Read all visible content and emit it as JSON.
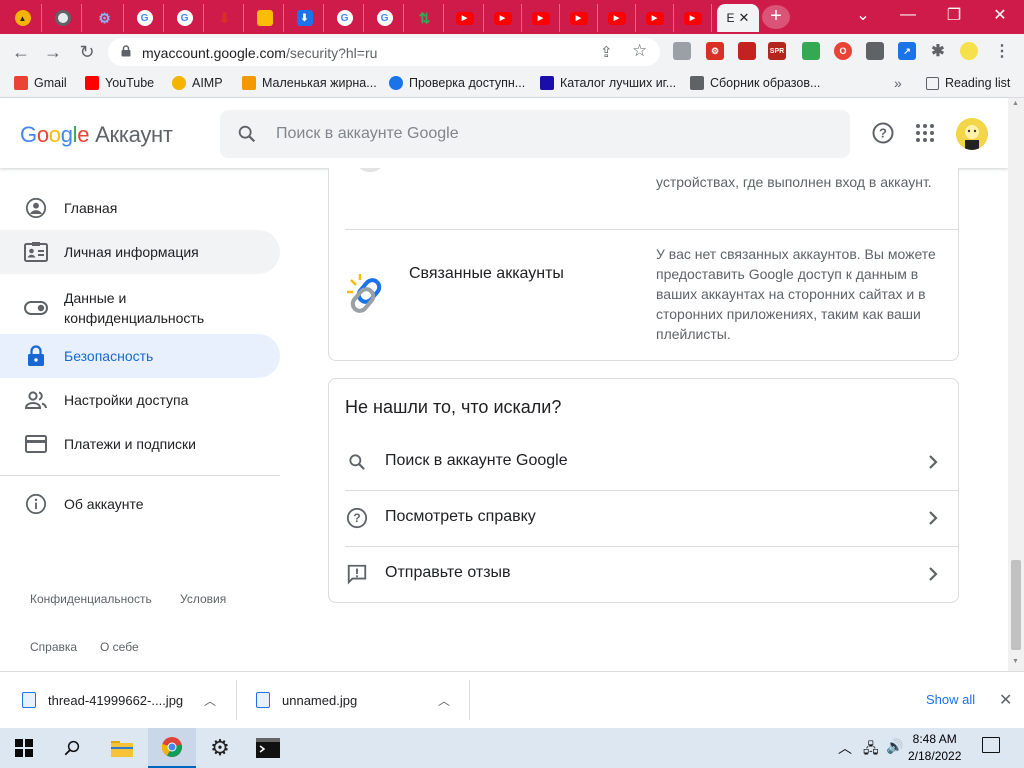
{
  "browser": {
    "tabs": [
      {
        "icon": "aimp-icon",
        "color": "#f5b400"
      },
      {
        "icon": "chrome-icon",
        "color": "#5f6368"
      },
      {
        "icon": "gear-icon",
        "color": "#8ab4f8"
      },
      {
        "icon": "google-icon",
        "color": "#ffffff"
      },
      {
        "icon": "google-icon",
        "color": "#ffffff"
      },
      {
        "icon": "download-arrow-icon",
        "color": "#d93025"
      },
      {
        "icon": "folder-icon",
        "color": "#fbbc05"
      },
      {
        "icon": "download-icon",
        "color": "#1a73e8"
      },
      {
        "icon": "google-icon",
        "color": "#ffffff"
      },
      {
        "icon": "google-icon",
        "color": "#ffffff"
      },
      {
        "icon": "arrows-icon",
        "color": "#34a853"
      },
      {
        "icon": "youtube-icon",
        "color": "#ff0000"
      },
      {
        "icon": "youtube-icon",
        "color": "#ff0000"
      },
      {
        "icon": "youtube-icon",
        "color": "#ff0000"
      },
      {
        "icon": "youtube-icon",
        "color": "#ff0000"
      },
      {
        "icon": "youtube-icon",
        "color": "#ff0000"
      },
      {
        "icon": "youtube-icon",
        "color": "#ff0000"
      },
      {
        "icon": "youtube-icon",
        "color": "#ff0000"
      }
    ],
    "active_tab_label": "E",
    "url_host": "myaccount.google.com",
    "url_path": "/security?hl=ru",
    "bookmarks": [
      {
        "label": "Gmail",
        "icon": "gmail-icon"
      },
      {
        "label": "YouTube",
        "icon": "youtube-icon"
      },
      {
        "label": "AIMP",
        "icon": "aimp-icon"
      },
      {
        "label": "Маленькая жирна...",
        "icon": "fire-icon"
      },
      {
        "label": "Проверка доступн...",
        "icon": "globe-icon"
      },
      {
        "label": "Каталог лучших иг...",
        "icon": "catalog-icon"
      },
      {
        "label": "Сборник образов...",
        "icon": "ms-icon"
      }
    ],
    "reading_list": "Reading list",
    "more_bookmarks": "»"
  },
  "header": {
    "logo_letters": [
      "G",
      "o",
      "o",
      "g",
      "l",
      "e"
    ],
    "product": "Аккаунт",
    "search_placeholder": "Поиск в аккаунте Google"
  },
  "sidebar": {
    "items": [
      {
        "label": "Главная",
        "icon": "home-person-icon"
      },
      {
        "label": "Личная информация",
        "icon": "id-card-icon"
      },
      {
        "label": "Данные и конфиденциальность",
        "icon": "toggle-icon"
      },
      {
        "label": "Безопасность",
        "icon": "lock-icon"
      },
      {
        "label": "Настройки доступа",
        "icon": "people-icon"
      },
      {
        "label": "Платежи и подписки",
        "icon": "credit-card-icon"
      },
      {
        "label": "Об аккаунте",
        "icon": "info-icon"
      }
    ],
    "footer": {
      "privacy": "Конфиденциальность",
      "terms": "Условия",
      "help": "Справка",
      "about": "О себе"
    }
  },
  "main": {
    "devices_desc": "устройствах, где выполнен вход в аккаунт.",
    "linked_accounts": {
      "title": "Связанные аккаунты",
      "desc": "У вас нет связанных аккаунтов. Вы можете предоставить Google доступ к данным в ваших аккаунтах на сторонних сайтах и в сторонних приложениях, таким как ваши плейлисты."
    },
    "not_found": {
      "heading": "Не нашли то, что искали?",
      "items": [
        {
          "label": "Поиск в аккаунте Google",
          "icon": "search-icon"
        },
        {
          "label": "Посмотреть справку",
          "icon": "help-circle-icon"
        },
        {
          "label": "Отправьте отзыв",
          "icon": "feedback-icon"
        }
      ]
    }
  },
  "downloads": {
    "items": [
      {
        "name": "thread-41999662-....jpg"
      },
      {
        "name": "unnamed.jpg"
      }
    ],
    "show_all": "Show all"
  },
  "taskbar": {
    "time": "8:48 AM",
    "date": "2/18/2022"
  }
}
